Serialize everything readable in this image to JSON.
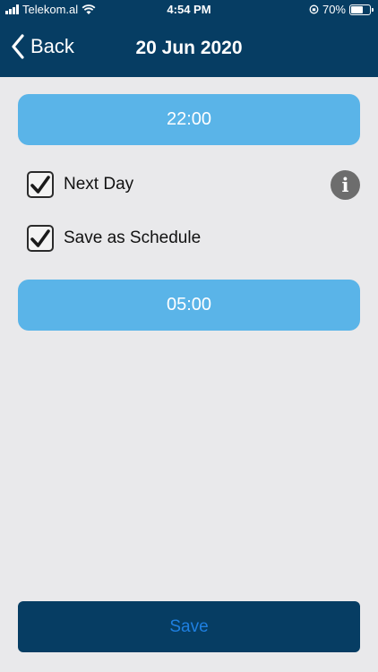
{
  "status_bar": {
    "carrier": "Telekom.al",
    "time": "4:54 PM",
    "battery": "70%",
    "battery_level": 0.7
  },
  "nav": {
    "back_label": "Back",
    "title": "20 Jun 2020"
  },
  "start_time": "22:00",
  "options": [
    {
      "label": "Next Day",
      "checked": true
    },
    {
      "label": "Save as Schedule",
      "checked": true
    }
  ],
  "end_time": "05:00",
  "save_label": "Save",
  "colors": {
    "header": "#063d63",
    "time_button": "#5ab4e8",
    "save_text": "#1e7fe0",
    "background": "#e9e9eb"
  }
}
